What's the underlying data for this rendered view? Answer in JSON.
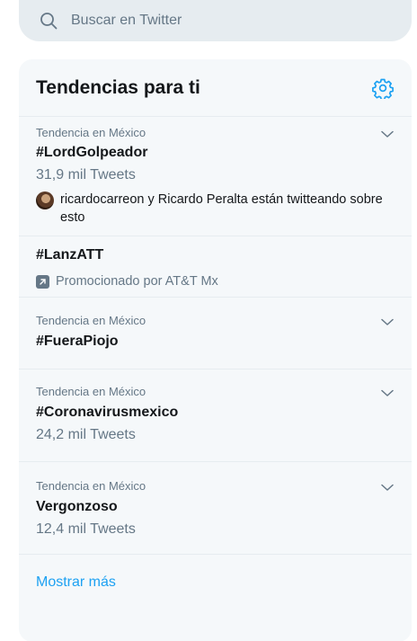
{
  "search": {
    "placeholder": "Buscar en Twitter",
    "icon": "search-icon"
  },
  "panel": {
    "title": "Tendencias para ti",
    "settings_icon": "gear-icon",
    "trends": [
      {
        "context": "Tendencia en México",
        "name": "#LordGolpeador",
        "count": "31,9 mil Tweets",
        "social": "ricardocarreon y Ricardo Peralta están twitteando sobre esto"
      },
      {
        "name": "#LanzATT",
        "promoted": "Promocionado por AT&T Mx"
      },
      {
        "context": "Tendencia en México",
        "name": "#FueraPiojo"
      },
      {
        "context": "Tendencia en México",
        "name": "#Coronavirusmexico",
        "count": "24,2 mil Tweets"
      },
      {
        "context": "Tendencia en México",
        "name": "Vergonzoso",
        "count": "12,4 mil Tweets"
      }
    ],
    "show_more": "Mostrar más"
  },
  "colors": {
    "accent": "#1da1f2",
    "muted": "#657786",
    "panel_bg": "#f5f8fa",
    "search_bg": "#e6ecf0"
  }
}
